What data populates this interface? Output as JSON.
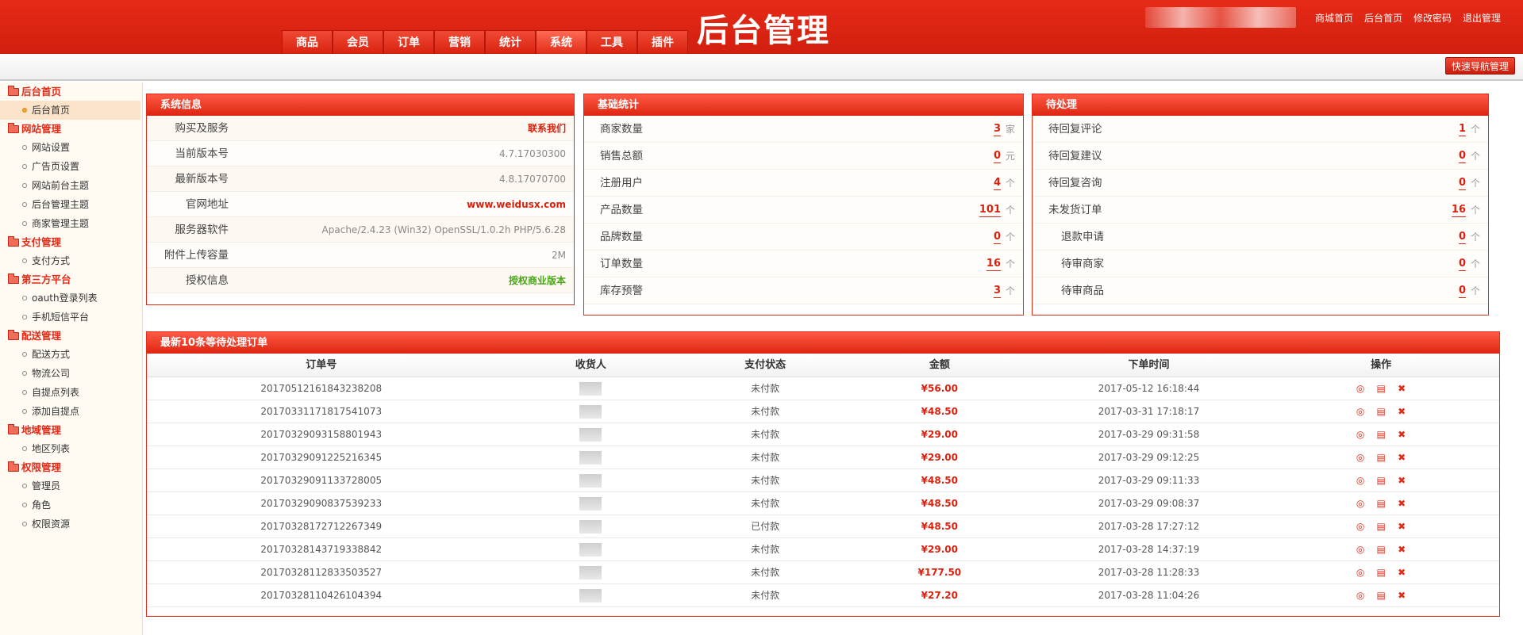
{
  "header": {
    "brand": "后台管理",
    "nav_tabs": [
      "商品",
      "会员",
      "订单",
      "营销",
      "统计",
      "系统",
      "工具",
      "插件"
    ],
    "active_tab": "系统",
    "top_links": [
      "商城首页",
      "后台首页",
      "修改密码",
      "退出管理"
    ],
    "quick_nav_label": "快速导航管理"
  },
  "sidebar": {
    "groups": [
      {
        "label": "后台首页",
        "items": [
          {
            "label": "后台首页",
            "active": true
          }
        ]
      },
      {
        "label": "网站管理",
        "items": [
          {
            "label": "网站设置"
          },
          {
            "label": "广告页设置"
          },
          {
            "label": "网站前台主题"
          },
          {
            "label": "后台管理主题"
          },
          {
            "label": "商家管理主题"
          }
        ]
      },
      {
        "label": "支付管理",
        "items": [
          {
            "label": "支付方式"
          }
        ]
      },
      {
        "label": "第三方平台",
        "items": [
          {
            "label": "oauth登录列表"
          },
          {
            "label": "手机短信平台"
          }
        ]
      },
      {
        "label": "配送管理",
        "items": [
          {
            "label": "配送方式"
          },
          {
            "label": "物流公司"
          },
          {
            "label": "自提点列表"
          },
          {
            "label": "添加自提点"
          }
        ]
      },
      {
        "label": "地域管理",
        "items": [
          {
            "label": "地区列表"
          }
        ]
      },
      {
        "label": "权限管理",
        "items": [
          {
            "label": "管理员"
          },
          {
            "label": "角色"
          },
          {
            "label": "权限资源"
          }
        ]
      }
    ]
  },
  "system_info": {
    "title": "系统信息",
    "rows": [
      {
        "label": "购买及服务",
        "value": "联系我们",
        "style": "red"
      },
      {
        "label": "当前版本号",
        "value": "4.7.17030300",
        "style": ""
      },
      {
        "label": "最新版本号",
        "value": "4.8.17070700",
        "style": ""
      },
      {
        "label": "官网地址",
        "value": "www.weidusx.com",
        "style": "red"
      },
      {
        "label": "服务器软件",
        "value": "Apache/2.4.23 (Win32) OpenSSL/1.0.2h PHP/5.6.28",
        "style": ""
      },
      {
        "label": "附件上传容量",
        "value": "2M",
        "style": ""
      },
      {
        "label": "授权信息",
        "value": "授权商业版本",
        "style": "green"
      }
    ]
  },
  "basic_stats": {
    "title": "基础统计",
    "rows": [
      {
        "label": "商家数量",
        "value": "3",
        "unit": "家"
      },
      {
        "label": "销售总额",
        "value": "0",
        "unit": "元"
      },
      {
        "label": "注册用户",
        "value": "4",
        "unit": "个"
      },
      {
        "label": "产品数量",
        "value": "101",
        "unit": "个"
      },
      {
        "label": "品牌数量",
        "value": "0",
        "unit": "个"
      },
      {
        "label": "订单数量",
        "value": "16",
        "unit": "个"
      },
      {
        "label": "库存预警",
        "value": "3",
        "unit": "个"
      }
    ]
  },
  "pending": {
    "title": "待处理",
    "rows": [
      {
        "label": "待回复评论",
        "value": "1",
        "unit": "个"
      },
      {
        "label": "待回复建议",
        "value": "0",
        "unit": "个"
      },
      {
        "label": "待回复咨询",
        "value": "0",
        "unit": "个"
      },
      {
        "label": "未发货订单",
        "value": "16",
        "unit": "个"
      },
      {
        "label": "退款申请",
        "value": "0",
        "unit": "个"
      },
      {
        "label": "待审商家",
        "value": "0",
        "unit": "个"
      },
      {
        "label": "待审商品",
        "value": "0",
        "unit": "个"
      }
    ]
  },
  "orders": {
    "title": "最新10条等待处理订单",
    "columns": [
      "订单号",
      "收货人",
      "支付状态",
      "金额",
      "下单时间",
      "操作"
    ],
    "rows": [
      {
        "id": "20170512161843238208",
        "status": "未付款",
        "amount": "¥56.00",
        "time": "2017-05-12 16:18:44"
      },
      {
        "id": "20170331171817541073",
        "status": "未付款",
        "amount": "¥48.50",
        "time": "2017-03-31 17:18:17"
      },
      {
        "id": "20170329093158801943",
        "status": "未付款",
        "amount": "¥29.00",
        "time": "2017-03-29 09:31:58"
      },
      {
        "id": "20170329091225216345",
        "status": "未付款",
        "amount": "¥29.00",
        "time": "2017-03-29 09:12:25"
      },
      {
        "id": "20170329091133728005",
        "status": "未付款",
        "amount": "¥48.50",
        "time": "2017-03-29 09:11:33"
      },
      {
        "id": "20170329090837539233",
        "status": "未付款",
        "amount": "¥48.50",
        "time": "2017-03-29 09:08:37"
      },
      {
        "id": "20170328172712267349",
        "status": "已付款",
        "amount": "¥48.50",
        "time": "2017-03-28 17:27:12"
      },
      {
        "id": "20170328143719338842",
        "status": "未付款",
        "amount": "¥29.00",
        "time": "2017-03-28 14:37:19"
      },
      {
        "id": "20170328112833503527",
        "status": "未付款",
        "amount": "¥177.50",
        "time": "2017-03-28 11:28:33"
      },
      {
        "id": "20170328110426104394",
        "status": "未付款",
        "amount": "¥27.20",
        "time": "2017-03-28 11:04:26"
      }
    ],
    "op_icons": [
      "view-icon",
      "document-icon",
      "delete-icon"
    ]
  },
  "colors": {
    "brand_red": "#e22c18",
    "money_red": "#d8220f",
    "green": "#48a617"
  }
}
